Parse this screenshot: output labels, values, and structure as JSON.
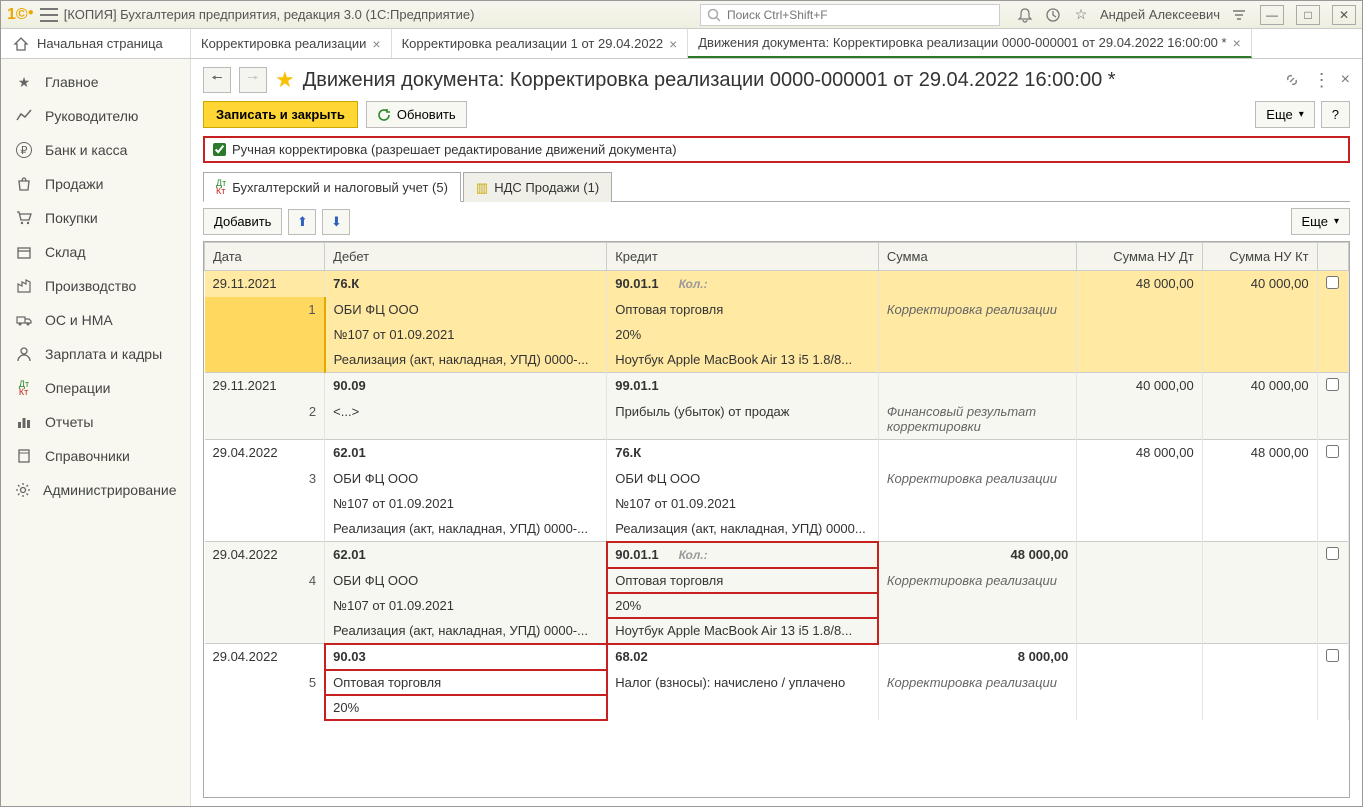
{
  "title_bar": {
    "app_title": "[КОПИЯ] Бухгалтерия предприятия, редакция 3.0  (1С:Предприятие)",
    "search_placeholder": "Поиск Ctrl+Shift+F",
    "user_name": "Андрей Алексеевич"
  },
  "tabs": {
    "home": "Начальная страница",
    "t1": "Корректировка реализации",
    "t2": "Корректировка реализации 1 от 29.04.2022",
    "t3": "Движения документа: Корректировка реализации 0000-000001 от 29.04.2022 16:00:00 *"
  },
  "sidebar": {
    "items": [
      {
        "label": "Главное",
        "icon": "★"
      },
      {
        "label": "Руководителю",
        "icon": "chart"
      },
      {
        "label": "Банк и касса",
        "icon": "₽"
      },
      {
        "label": "Продажи",
        "icon": "bag"
      },
      {
        "label": "Покупки",
        "icon": "cart"
      },
      {
        "label": "Склад",
        "icon": "box"
      },
      {
        "label": "Производство",
        "icon": "factory"
      },
      {
        "label": "ОС и НМА",
        "icon": "truck"
      },
      {
        "label": "Зарплата и кадры",
        "icon": "person"
      },
      {
        "label": "Операции",
        "icon": "dtkt"
      },
      {
        "label": "Отчеты",
        "icon": "barchart"
      },
      {
        "label": "Справочники",
        "icon": "book"
      },
      {
        "label": "Администрирование",
        "icon": "gear"
      }
    ]
  },
  "page": {
    "title": "Движения документа: Корректировка реализации 0000-000001 от 29.04.2022 16:00:00 *",
    "save_close": "Записать и закрыть",
    "refresh": "Обновить",
    "more": "Еще",
    "help": "?",
    "checkbox_label": "Ручная корректировка (разрешает редактирование движений документа)",
    "subtabs": {
      "accounting": "Бухгалтерский и налоговый учет (5)",
      "vat": "НДС Продажи (1)"
    },
    "add": "Добавить"
  },
  "table": {
    "headers": {
      "date": "Дата",
      "debit": "Дебет",
      "credit": "Кредит",
      "summ": "Сумма",
      "nudt": "Сумма НУ Дт",
      "nukt": "Сумма НУ Кт"
    },
    "kol_label": "Кол.:",
    "rows": [
      {
        "n": "1",
        "date": "29.11.2021",
        "d_acc": "76.К",
        "d_l1": "ОБИ ФЦ ООО",
        "d_l2": "№107 от 01.09.2021",
        "d_l3": "Реализация (акт, накладная, УПД) 0000-...",
        "c_acc": "90.01.1",
        "c_kol": true,
        "c_l1": "Оптовая торговля",
        "c_l2": "20%",
        "c_l3": "Ноутбук Apple MacBook Air 13 i5 1.8/8...",
        "summ": "",
        "desc": "Корректировка реализации",
        "nudt": "48 000,00",
        "nukt": "40 000,00",
        "selected": true
      },
      {
        "n": "2",
        "date": "29.11.2021",
        "d_acc": "90.09",
        "d_l1": "<...>",
        "d_l2": "",
        "d_l3": "",
        "c_acc": "99.01.1",
        "c_l1": "Прибыль (убыток) от продаж",
        "c_l2": "",
        "c_l3": "",
        "summ": "",
        "desc": "Финансовый результат корректировки",
        "nudt": "40 000,00",
        "nukt": "40 000,00"
      },
      {
        "n": "3",
        "date": "29.04.2022",
        "d_acc": "62.01",
        "d_l1": "ОБИ ФЦ ООО",
        "d_l2": "№107 от 01.09.2021",
        "d_l3": "Реализация (акт, накладная, УПД) 0000-...",
        "c_acc": "76.К",
        "c_l1": "ОБИ ФЦ ООО",
        "c_l2": "№107 от 01.09.2021",
        "c_l3": "Реализация (акт, накладная, УПД) 0000...",
        "summ": "",
        "desc": "Корректировка реализации",
        "nudt": "48 000,00",
        "nukt": "48 000,00"
      },
      {
        "n": "4",
        "date": "29.04.2022",
        "d_acc": "62.01",
        "d_l1": "ОБИ ФЦ ООО",
        "d_l2": "№107 от 01.09.2021",
        "d_l3": "Реализация (акт, накладная, УПД) 0000-...",
        "c_acc": "90.01.1",
        "c_kol": true,
        "c_l1": "Оптовая торговля",
        "c_l2": "20%",
        "c_l3": "Ноутбук Apple MacBook Air 13 i5 1.8/8...",
        "summ": "48 000,00",
        "desc": "Корректировка реализации",
        "nudt": "",
        "nukt": "",
        "red_credit": true
      },
      {
        "n": "5",
        "date": "29.04.2022",
        "d_acc": "90.03",
        "d_l1": "Оптовая торговля",
        "d_l2": "20%",
        "d_l3": "",
        "c_acc": "68.02",
        "c_l1": "Налог (взносы): начислено / уплачено",
        "c_l2": "",
        "c_l3": "",
        "summ": "8 000,00",
        "desc": "Корректировка реализации",
        "nudt": "",
        "nukt": "",
        "red_debit": true
      }
    ]
  }
}
